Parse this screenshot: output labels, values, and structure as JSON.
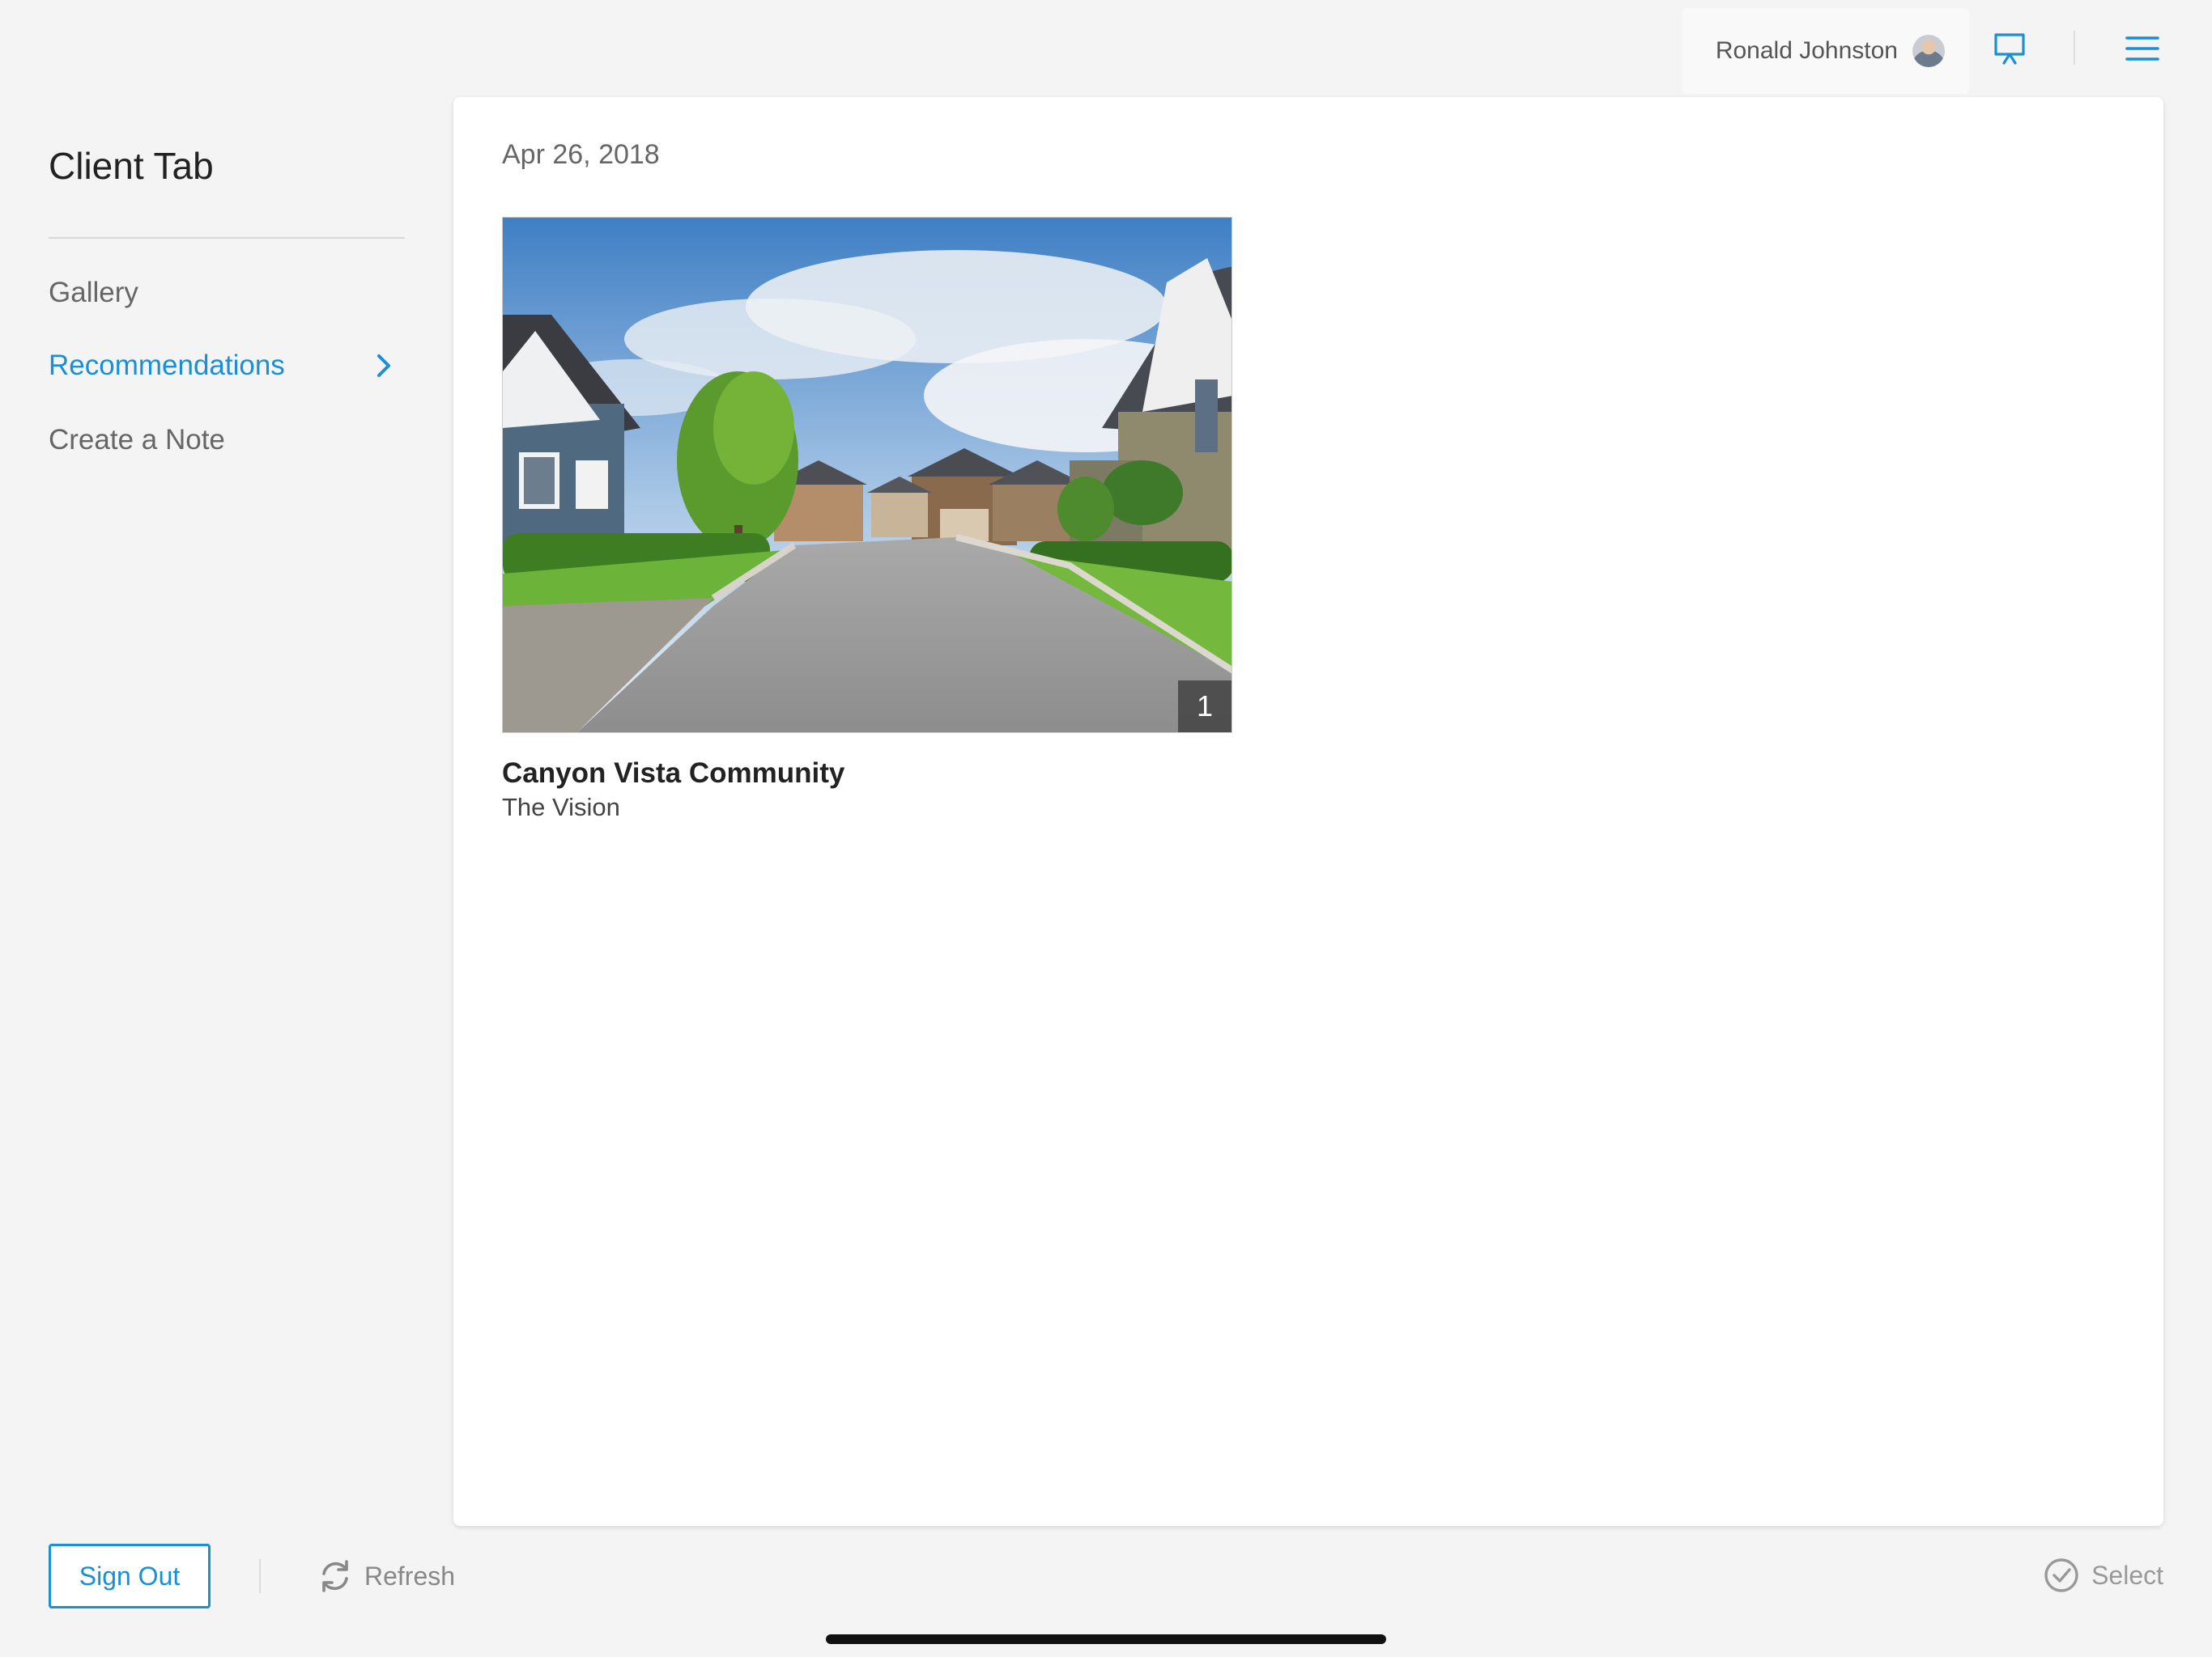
{
  "header": {
    "user_name": "Ronald Johnston"
  },
  "sidebar": {
    "title": "Client Tab",
    "items": [
      {
        "label": "Gallery",
        "active": false
      },
      {
        "label": "Recommendations",
        "active": true
      },
      {
        "label": "Create a Note",
        "active": false
      }
    ]
  },
  "main": {
    "date": "Apr 26, 2018",
    "item": {
      "title": "Canyon Vista Community",
      "subtitle": "The Vision",
      "image_count": "1"
    }
  },
  "footer": {
    "sign_out_label": "Sign Out",
    "refresh_label": "Refresh",
    "select_label": "Select"
  },
  "colors": {
    "accent": "#1a8fd6",
    "background": "#f4f4f4",
    "card": "#ffffff"
  },
  "icons": {
    "present": "presentation-icon",
    "menu": "hamburger-menu-icon",
    "chevron": "chevron-right-icon",
    "refresh": "refresh-icon",
    "select": "check-circle-icon"
  }
}
